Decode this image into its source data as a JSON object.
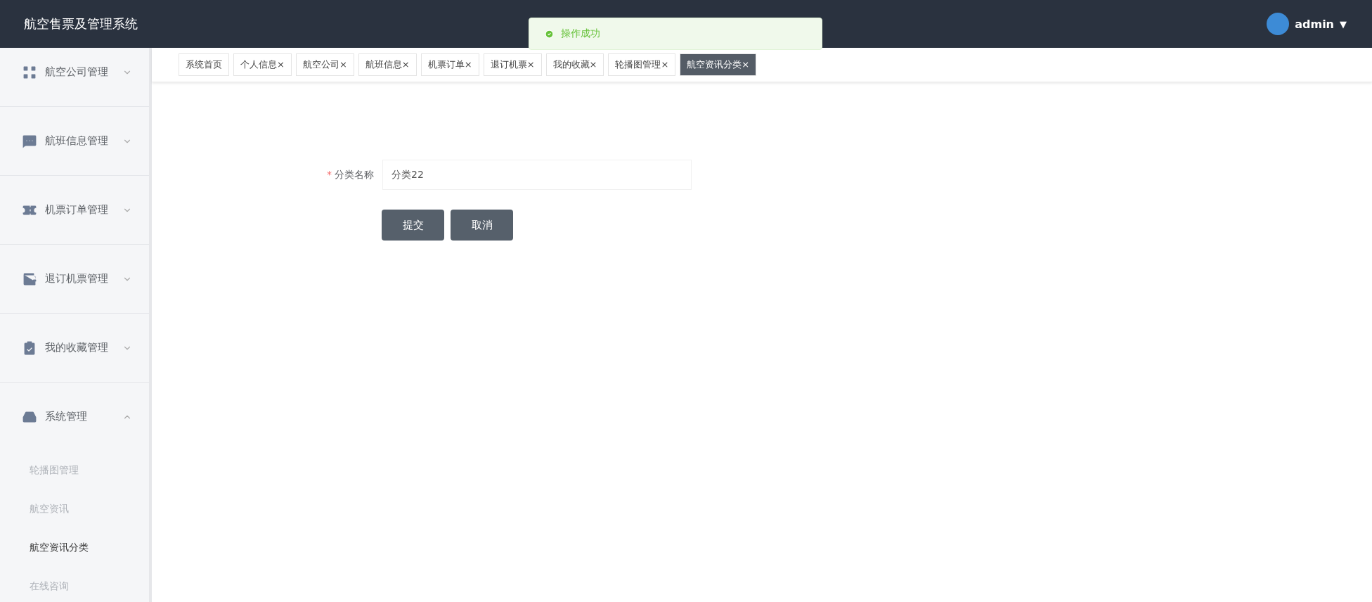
{
  "header": {
    "title": "航空售票及管理系统",
    "user": "admin",
    "menu_caret": "▼"
  },
  "toast": {
    "message": "操作成功"
  },
  "sidebar": {
    "items": [
      {
        "label": "航空公司管理",
        "expanded": false
      },
      {
        "label": "航班信息管理",
        "expanded": false
      },
      {
        "label": "机票订单管理",
        "expanded": false
      },
      {
        "label": "退订机票管理",
        "expanded": false
      },
      {
        "label": "我的收藏管理",
        "expanded": false
      },
      {
        "label": "系统管理",
        "expanded": true,
        "children": [
          {
            "label": "轮播图管理",
            "selected": false
          },
          {
            "label": "航空资讯",
            "selected": false
          },
          {
            "label": "航空资讯分类",
            "selected": true
          },
          {
            "label": "在线咨询",
            "selected": false
          }
        ]
      }
    ]
  },
  "tabs": [
    {
      "label": "系统首页",
      "selected": false
    },
    {
      "label": "个人信息×",
      "selected": false
    },
    {
      "label": "航空公司×",
      "selected": false
    },
    {
      "label": "航班信息×",
      "selected": false
    },
    {
      "label": "机票订单×",
      "selected": false
    },
    {
      "label": "退订机票×",
      "selected": false
    },
    {
      "label": "我的收藏×",
      "selected": false
    },
    {
      "label": "轮播图管理×",
      "selected": false
    },
    {
      "label": "航空资讯分类×",
      "selected": true
    }
  ],
  "form": {
    "fields": [
      {
        "label": "分类名称",
        "required_mark": "*",
        "value": "分类22"
      }
    ],
    "buttons": [
      "提交",
      "取消"
    ]
  }
}
